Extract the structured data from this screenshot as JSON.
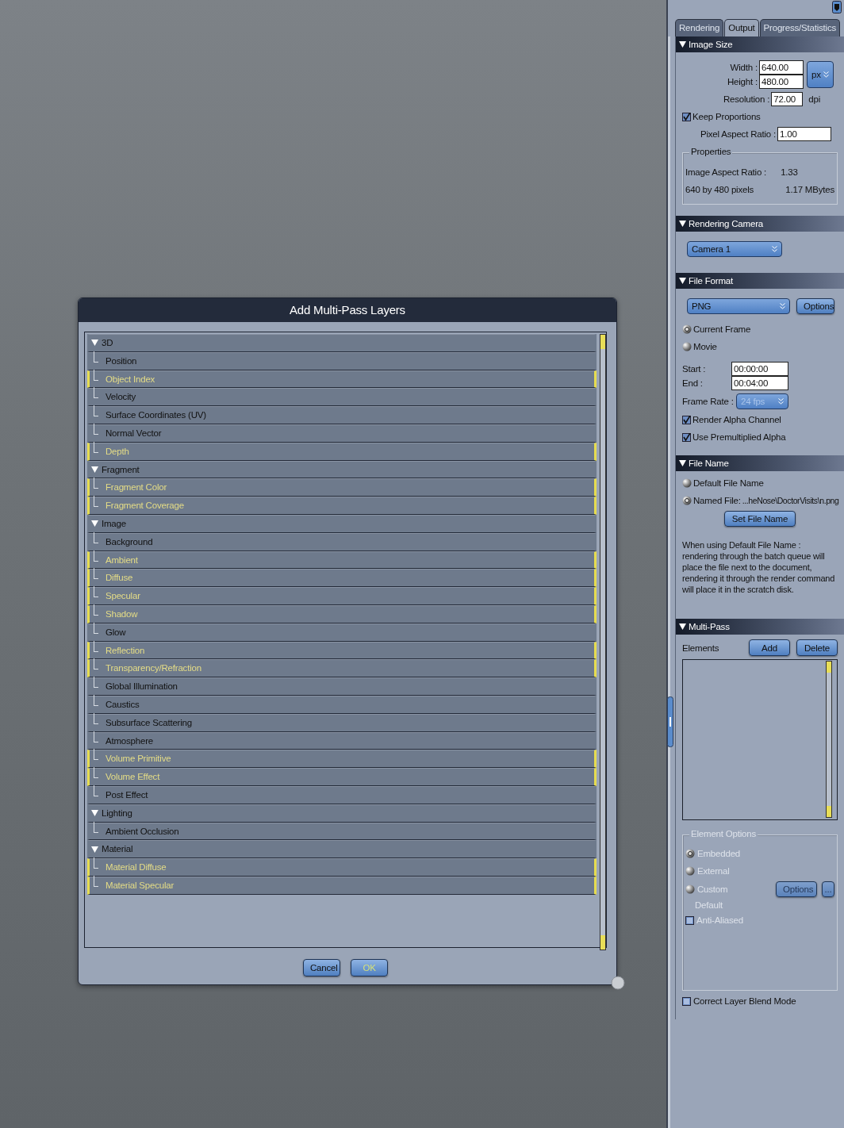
{
  "dialog": {
    "title": "Add Multi-Pass Layers",
    "groups": [
      {
        "label": "3D",
        "expanded": true,
        "children": [
          {
            "label": "Position",
            "selected": false
          },
          {
            "label": "Object Index",
            "selected": true
          },
          {
            "label": "Velocity",
            "selected": false
          },
          {
            "label": "Surface Coordinates (UV)",
            "selected": false
          },
          {
            "label": "Normal Vector",
            "selected": false
          },
          {
            "label": "Depth",
            "selected": true
          }
        ]
      },
      {
        "label": "Fragment",
        "expanded": true,
        "children": [
          {
            "label": "Fragment Color",
            "selected": true
          },
          {
            "label": "Fragment Coverage",
            "selected": true
          }
        ]
      },
      {
        "label": "Image",
        "expanded": true,
        "children": [
          {
            "label": "Background",
            "selected": false
          },
          {
            "label": "Ambient",
            "selected": true
          },
          {
            "label": "Diffuse",
            "selected": true
          },
          {
            "label": "Specular",
            "selected": true
          },
          {
            "label": "Shadow",
            "selected": true
          },
          {
            "label": "Glow",
            "selected": false
          },
          {
            "label": "Reflection",
            "selected": true
          },
          {
            "label": "Transparency/Refraction",
            "selected": true
          },
          {
            "label": "Global Illumination",
            "selected": false
          },
          {
            "label": "Caustics",
            "selected": false
          },
          {
            "label": "Subsurface Scattering",
            "selected": false
          },
          {
            "label": "Atmosphere",
            "selected": false
          },
          {
            "label": "Volume Primitive",
            "selected": true
          },
          {
            "label": "Volume Effect",
            "selected": true
          },
          {
            "label": "Post Effect",
            "selected": false
          }
        ]
      },
      {
        "label": "Lighting",
        "expanded": true,
        "children": [
          {
            "label": "Ambient Occlusion",
            "selected": false
          }
        ]
      },
      {
        "label": "Material",
        "expanded": true,
        "children": [
          {
            "label": "Material Diffuse",
            "selected": true
          },
          {
            "label": "Material Specular",
            "selected": true
          }
        ]
      }
    ],
    "buttons": [
      {
        "label": "Cancel",
        "kind": "normal"
      },
      {
        "label": "OK",
        "kind": "default"
      }
    ]
  },
  "panel": {
    "tabs": [
      {
        "label": "Rendering",
        "selected": false
      },
      {
        "label": "Output",
        "selected": true
      },
      {
        "label": "Progress/Statistics",
        "selected": false
      }
    ],
    "sections": [
      {
        "title": "Image Size",
        "expanded": true,
        "items": [
          {
            "kind": "size",
            "fields": [
              {
                "label": "Width :",
                "value": "640.00"
              },
              {
                "label": "Height :",
                "value": "480.00"
              }
            ],
            "unit": "px"
          },
          {
            "kind": "field",
            "label": "Resolution :",
            "value": "72.00",
            "suffix": "dpi"
          },
          {
            "kind": "checkbox",
            "label": "Keep Proportions",
            "checked": true
          },
          {
            "kind": "field",
            "label": "Pixel Aspect Ratio :",
            "value": "1.00"
          },
          {
            "kind": "group",
            "title": "Properties",
            "disabled": false,
            "items": [
              {
                "kind": "pair",
                "label": "Image Aspect Ratio :",
                "value": "1.33"
              },
              {
                "kind": "split",
                "label": "640 by 480 pixels",
                "value": "1.17 MBytes"
              }
            ]
          }
        ]
      },
      {
        "title": "Rendering Camera",
        "expanded": true,
        "items": [
          {
            "kind": "dropdown",
            "value": "Camera 1"
          }
        ]
      },
      {
        "title": "File Format",
        "expanded": true,
        "items": [
          {
            "kind": "dropdown",
            "value": "PNG",
            "button": "Options"
          },
          {
            "kind": "radio",
            "label": "Current Frame",
            "selected": true
          },
          {
            "kind": "radio",
            "label": "Movie",
            "selected": false
          },
          {
            "kind": "times",
            "fields": [
              {
                "label": "Start :",
                "value": "00:00:00"
              },
              {
                "label": "End :",
                "value": "00:04:00"
              }
            ]
          },
          {
            "kind": "select",
            "label": "Frame Rate :",
            "value": "24 fps",
            "disabled": true
          },
          {
            "kind": "checkbox",
            "label": "Render Alpha Channel",
            "checked": true
          },
          {
            "kind": "checkbox",
            "label": "Use Premultiplied Alpha",
            "checked": true
          }
        ]
      },
      {
        "title": "File Name",
        "expanded": true,
        "items": [
          {
            "kind": "radio",
            "label": "Default File Name",
            "selected": false
          },
          {
            "kind": "radio",
            "label": "Named File:",
            "selected": true,
            "value": "...heNose\\DoctorVisits\\n.png"
          },
          {
            "kind": "button",
            "label": "Set File Name"
          },
          {
            "kind": "note",
            "text": "When using Default File Name : rendering through the batch queue will place the file next to the document, rendering it through the render command will place it in the scratch disk."
          }
        ]
      },
      {
        "title": "Multi-Pass",
        "expanded": true,
        "items": [
          {
            "kind": "list-header",
            "label": "Elements",
            "buttons": [
              "Add",
              "Delete"
            ]
          },
          {
            "kind": "listbox"
          },
          {
            "kind": "group",
            "title": "Element Options",
            "disabled": true,
            "items": [
              {
                "kind": "radio",
                "label": "Embedded",
                "selected": true
              },
              {
                "kind": "radio",
                "label": "External",
                "selected": false
              },
              {
                "kind": "radio",
                "label": "Custom",
                "selected": false,
                "buttons": [
                  "Options",
                  "..."
                ]
              },
              {
                "kind": "text",
                "label": "Default"
              },
              {
                "kind": "checkbox",
                "label": "Anti-Aliased",
                "checked": false
              }
            ]
          },
          {
            "kind": "checkbox",
            "label": "Correct Layer Blend Mode",
            "checked": false
          }
        ]
      }
    ]
  }
}
